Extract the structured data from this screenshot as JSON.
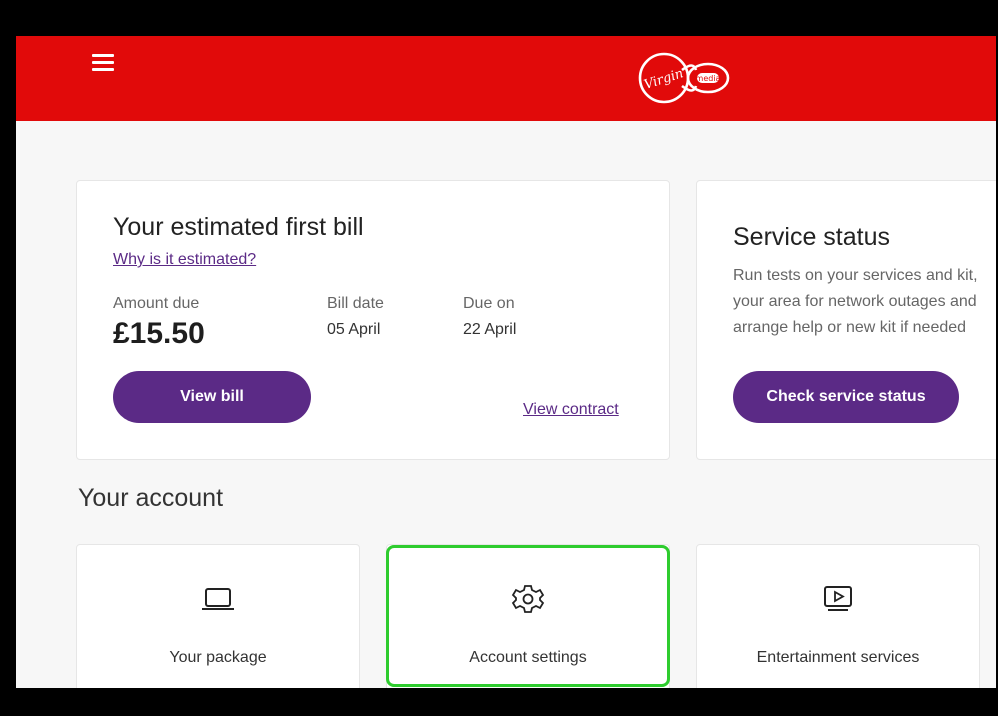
{
  "header": {
    "menu_icon": "hamburger-menu-icon",
    "logo": "virgin-media-logo",
    "logo_text": "Virgin media",
    "background_color": "#e10a0a"
  },
  "bill_card": {
    "title": "Your estimated first bill",
    "why_link": "Why is it estimated?",
    "amount_label": "Amount due",
    "amount_value": "£15.50",
    "bill_date_label": "Bill date",
    "bill_date_value": "05 April",
    "due_on_label": "Due on",
    "due_on_value": "22 April",
    "view_bill_button": "View bill",
    "view_contract_link": "View contract"
  },
  "status_card": {
    "title": "Service status",
    "description_lines": [
      "Run tests on your services and kit,",
      "your area for network outages and",
      "arrange help or new kit if needed"
    ],
    "check_button": "Check service status"
  },
  "account": {
    "section_title": "Your account",
    "tiles": [
      {
        "label": "Your package",
        "icon": "laptop-icon"
      },
      {
        "label": "Account settings",
        "icon": "gear-icon"
      },
      {
        "label": "Entertainment services",
        "icon": "tv-play-icon"
      }
    ]
  },
  "colors": {
    "accent_purple": "#5b2a86",
    "highlight_green": "#2ecc2e"
  }
}
